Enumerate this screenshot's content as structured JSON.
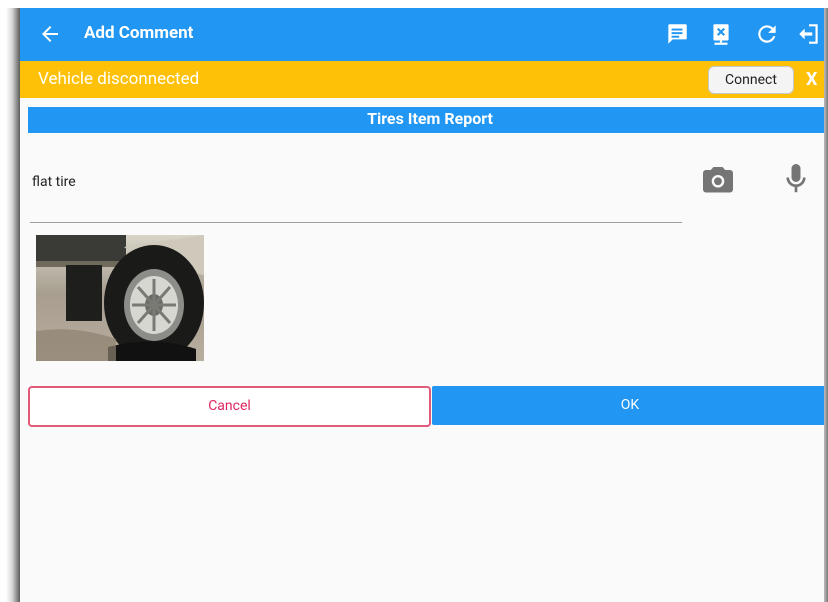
{
  "appbar": {
    "title": "Add Comment",
    "back_icon": "arrow-back-icon",
    "actions": [
      "comment-icon",
      "disconnected-device-icon",
      "refresh-icon",
      "logout-icon"
    ]
  },
  "warning": {
    "message": "Vehicle disconnected",
    "connect_label": "Connect",
    "close_label": "X"
  },
  "report": {
    "section_title": "Tires Item Report",
    "comment_value": "flat tire"
  },
  "buttons": {
    "cancel_label": "Cancel",
    "ok_label": "OK"
  },
  "colors": {
    "primary": "#2196f3",
    "warning": "#ffc107",
    "cancel_text": "#e0245e"
  }
}
